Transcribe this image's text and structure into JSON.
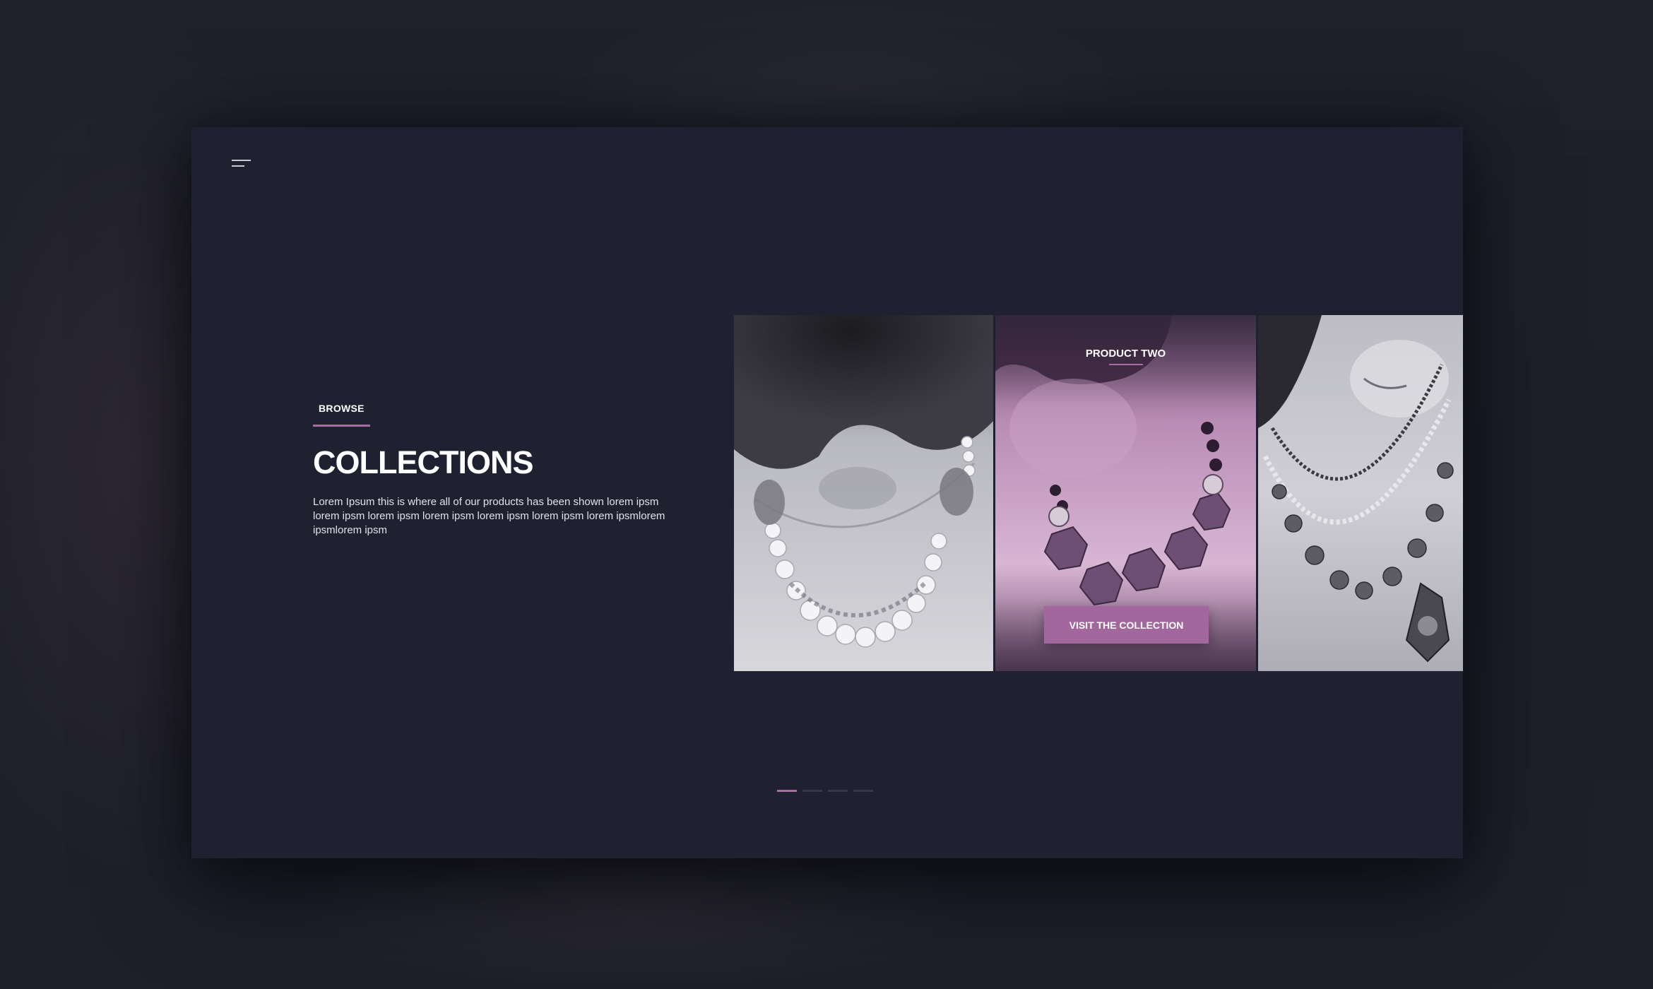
{
  "brand_color": "#a56da0",
  "menu": {
    "icon": "hamburger-menu-icon"
  },
  "hero": {
    "eyebrow": "BROWSE",
    "title": "COLLECTIONS",
    "description": "Lorem Ipsum this is where all of our products has been shown lorem ipsm lorem ipsm lorem ipsm lorem ipsm lorem ipsm lorem ipsm lorem ipsmlorem ipsmlorem ipsm"
  },
  "gallery": {
    "active_product": {
      "label": "PRODUCT TWO",
      "cta": "VISIT THE COLLECTION"
    }
  },
  "pager": {
    "count": 4,
    "active_index": 0
  }
}
